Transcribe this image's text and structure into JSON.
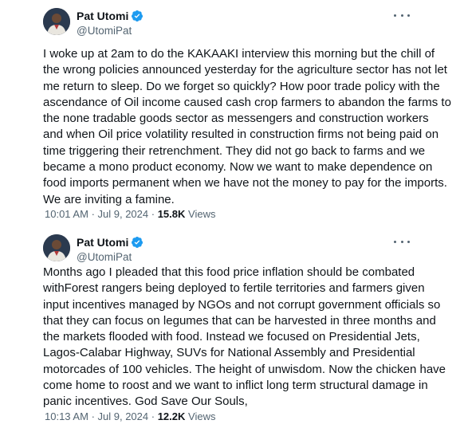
{
  "tweets": [
    {
      "author_name": "Pat Utomi",
      "handle": "@UtomiPat",
      "text": "I woke up at 2am to do the KAKAAKI interview this morning but the chill of the wrong policies announced yesterday for the agriculture sector has not let me return to sleep. Do we forget so quickly? How poor trade policy with the ascendance of Oil income caused cash crop farmers to abandon the farms to the none tradable goods sector as messengers and construction workers and when Oil price volatility resulted in construction firms not being paid on time triggering their retrenchment. They did not go back to farms and we became a mono product economy. Now we want to make dependence on food imports permanent when we have not the money to pay for the imports. We are inviting a famine.",
      "time": "10:01 AM",
      "date": "Jul 9, 2024",
      "views_count": "15.8K",
      "views_label": "Views"
    },
    {
      "author_name": "Pat Utomi",
      "handle": "@UtomiPat",
      "text": "Months ago I pleaded that this food price inflation should be combated withForest rangers being deployed to fertile territories and farmers given input incentives managed by NGOs and not corrupt government officials so that they can focus on legumes that can be harvested in three months and the markets flooded with food. Instead we focused on Presidential Jets, Lagos-Calabar Highway, SUVs for National Assembly and Presidential motorcades of 100 vehicles. The height of unwisdom. Now the chicken have come home to roost and we want to inflict long term structural damage in panic incentives. God Save Our Souls,",
      "time": "10:13 AM",
      "date": "Jul 9, 2024",
      "views_count": "12.2K",
      "views_label": "Views"
    }
  ],
  "colors": {
    "verified_badge": "#1d9bf0",
    "secondary_text": "#536471",
    "primary_text": "#0f1419"
  },
  "icons": [
    "avatar-photo",
    "verified-badge-icon",
    "more-options-icon"
  ]
}
